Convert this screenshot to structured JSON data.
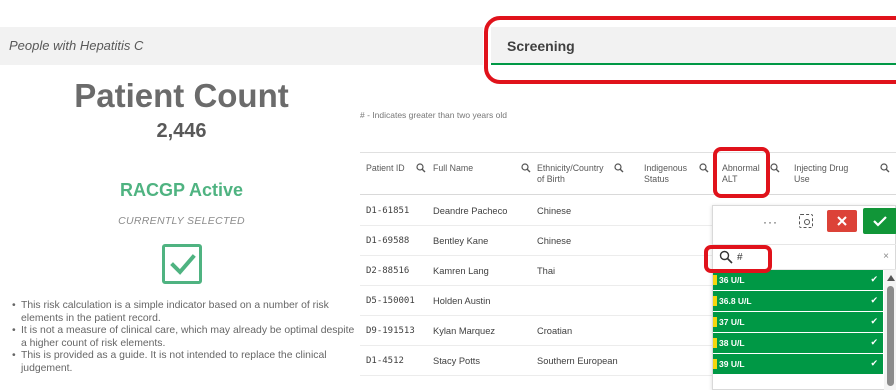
{
  "header": {
    "left_title": "People with Hepatitis C",
    "right_title": "Screening"
  },
  "kpi": {
    "title": "Patient Count",
    "value": "2,446",
    "subtitle": "RACGP Active",
    "status": "CURRENTLY SELECTED"
  },
  "notes": [
    "This risk calculation is a simple indicator based on a number of risk elements in the patient record.",
    "It is not a measure of clinical care, which may already be optimal despite a higher count of risk elements.",
    "This is provided as a guide. It is not intended to replace the clinical judgement."
  ],
  "table": {
    "note": "# - Indicates greater than two years old",
    "columns": [
      "Patient ID",
      "Full Name",
      "Ethnicity/Country of Birth",
      "Indigenous Status",
      "Abnormal ALT",
      "Injecting Drug Use"
    ],
    "rows": [
      {
        "id": "D1-61851",
        "name": "Deandre Pacheco",
        "ethnicity": "Chinese"
      },
      {
        "id": "D1-69588",
        "name": "Bentley Kane",
        "ethnicity": "Chinese"
      },
      {
        "id": "D2-88516",
        "name": "Kamren Lang",
        "ethnicity": "Thai"
      },
      {
        "id": "D5-150001",
        "name": "Holden Austin",
        "ethnicity": ""
      },
      {
        "id": "D9-191513",
        "name": "Kylan Marquez",
        "ethnicity": "Croatian"
      },
      {
        "id": "D1-4512",
        "name": "Stacy Potts",
        "ethnicity": "Southern European"
      }
    ]
  },
  "popup": {
    "more_label": "···",
    "search_text": "#",
    "clear_label": "×",
    "items": [
      "36 U/L",
      "36.8 U/L",
      "37 U/L",
      "38 U/L",
      "39 U/L"
    ]
  },
  "colors": {
    "accent_green": "#009845",
    "highlight_red": "#e0121b",
    "racgp_green": "#4fb381"
  }
}
